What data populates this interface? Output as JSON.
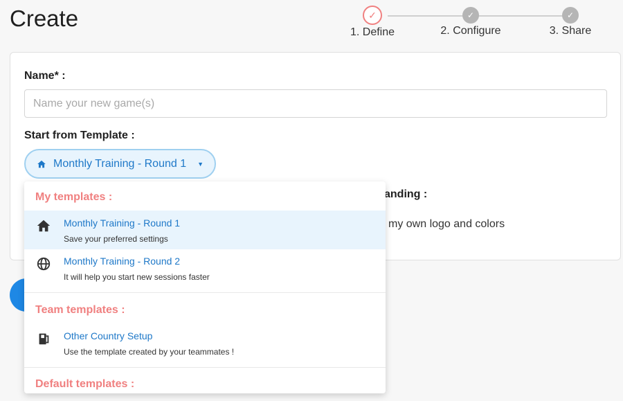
{
  "page": {
    "title": "Create"
  },
  "stepper": {
    "steps": [
      {
        "label": "1. Define",
        "state": "active"
      },
      {
        "label": "2. Configure",
        "state": "done"
      },
      {
        "label": "3. Share",
        "state": "done"
      }
    ]
  },
  "form": {
    "name_label": "Name* :",
    "name_placeholder": "Name your new game(s)",
    "name_value": "",
    "template_label": "Start from Template :",
    "template_selected": "Monthly Training - Round 1",
    "branding_label_partial": "anding :",
    "branding_text_partial": "my own logo and colors"
  },
  "dropdown": {
    "groups": [
      {
        "title": "My templates :",
        "options": [
          {
            "title": "Monthly Training - Round 1",
            "desc": "Save your preferred settings",
            "icon": "home-icon",
            "selected": true
          },
          {
            "title": "Monthly Training - Round 2",
            "desc": "It will help you start new sessions faster",
            "icon": "globe-icon",
            "selected": false
          }
        ]
      },
      {
        "title": "Team templates :",
        "options": [
          {
            "title": "Other Country Setup",
            "desc": "Use the template created by your teammates !",
            "icon": "team-template-icon",
            "selected": false
          }
        ]
      },
      {
        "title": "Default templates :",
        "options": []
      }
    ]
  },
  "colors": {
    "accent": "#1e78c8",
    "group_title": "#f08080",
    "selected_bg": "#e8f4fd",
    "primary_button": "#1e88e5"
  }
}
